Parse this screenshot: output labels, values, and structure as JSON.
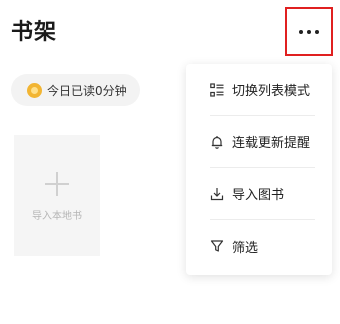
{
  "header": {
    "title": "书架"
  },
  "reading": {
    "text": "今日已读0分钟"
  },
  "import_card": {
    "label": "导入本地书"
  },
  "menu": {
    "items": [
      {
        "label": "切换列表模式",
        "icon": "list-mode-icon"
      },
      {
        "label": "连载更新提醒",
        "icon": "bell-icon"
      },
      {
        "label": "导入图书",
        "icon": "download-icon"
      },
      {
        "label": "筛选",
        "icon": "filter-icon"
      }
    ]
  },
  "colors": {
    "highlight_border": "#e02020",
    "coin": "#f2b533"
  }
}
